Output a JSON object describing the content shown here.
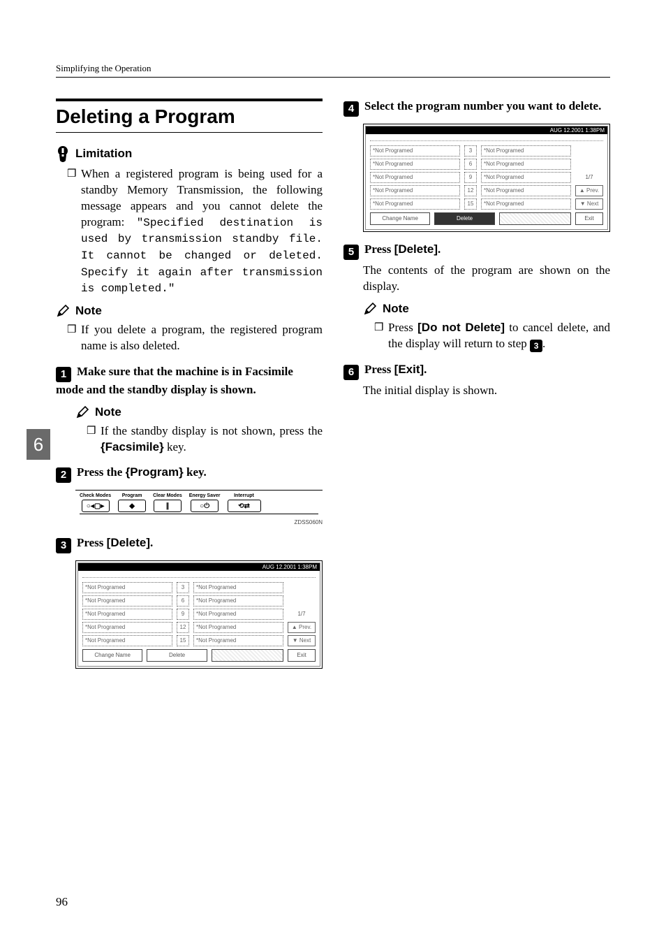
{
  "running_head": "Simplifying the Operation",
  "section_title": "Deleting a Program",
  "limitation_label": "Limitation",
  "limitation_body_pre": "When a registered program is being used for a standby Memory Transmission, the following message appears and you cannot delete the program: ",
  "limitation_body_mono": "\"Specified destination is used by transmission standby file. It cannot be changed or deleted. Specify it again after transmission is completed.\"",
  "note_label": "Note",
  "note1_body": "If you delete a program, the registered program name is also deleted.",
  "step1_text": "Make sure that the machine is in Facsimile mode and the standby display is shown.",
  "step1_note_pre": "If the standby display is not shown, press the ",
  "step1_note_key": "Facsimile",
  "step1_note_post": " key.",
  "step2_pre": "Press the ",
  "step2_key": "Program",
  "step2_post": " key.",
  "step3_pre": "Press ",
  "step3_key": "[Delete]",
  "step3_post": ".",
  "step4_text": "Select the program number you want to delete.",
  "step5_pre": "Press ",
  "step5_key": "[Delete]",
  "step5_post": ".",
  "step5_body": "The contents of the program are shown on the display.",
  "step5_note_pre": "Press ",
  "step5_note_key": "[Do not Delete]",
  "step5_note_mid": " to cancel delete, and the display will return to step ",
  "step5_note_ref": "3",
  "step5_note_post": ".",
  "step6_pre": "Press ",
  "step6_key": "[Exit]",
  "step6_post": ".",
  "step6_body": "The initial display is shown.",
  "keypanel": {
    "labels": [
      "Check Modes",
      "Program",
      "Clear Modes",
      "Energy Saver",
      "Interrupt"
    ],
    "tag": "ZDSS060N"
  },
  "screenshot": {
    "timestamp": "AUG   12.2001  1:38PM",
    "left_slots": [
      "*Not Programed",
      "*Not Programed",
      "*Not Programed",
      "*Not Programed",
      "*Not Programed"
    ],
    "mid_nums": [
      "3",
      "6",
      "9",
      "12",
      "15"
    ],
    "right_slots": [
      "*Not Programed",
      "*Not Programed",
      "*Not Programed",
      "*Not Programed",
      "*Not Programed"
    ],
    "side": {
      "page": "1/7",
      "prev": "▲ Prev.",
      "next": "▼ Next"
    },
    "bottom": {
      "change": "Change Name",
      "delete": "Delete",
      "exit": "Exit"
    }
  },
  "side_tab": "6",
  "page_number": "96"
}
